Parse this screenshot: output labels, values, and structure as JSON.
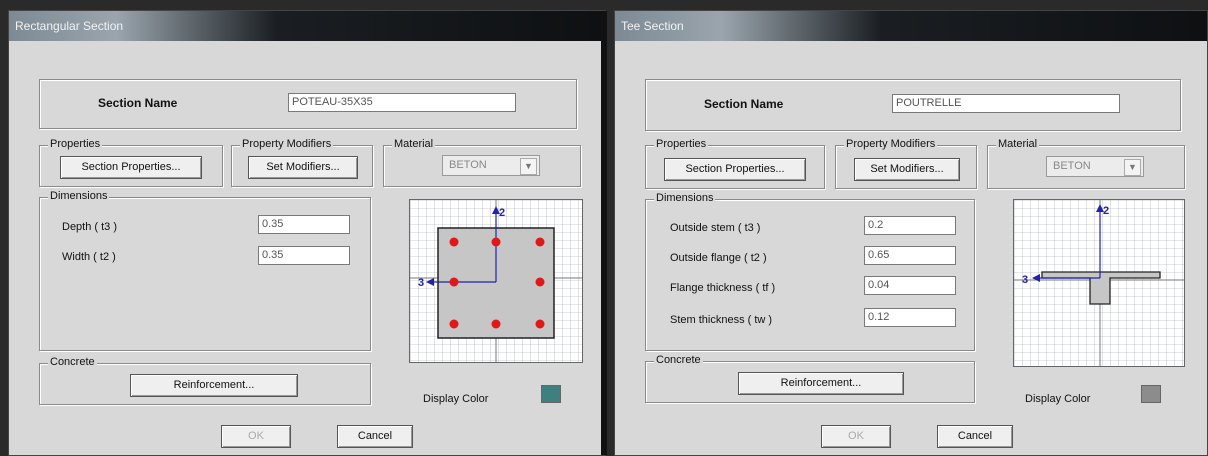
{
  "left": {
    "title": "Rectangular Section",
    "section_name_label": "Section Name",
    "section_name_value": "POTEAU-35X35",
    "properties_legend": "Properties",
    "section_properties_btn": "Section Properties...",
    "modifiers_legend": "Property Modifiers",
    "set_modifiers_btn": "Set Modifiers...",
    "material_legend": "Material",
    "material_value": "BETON",
    "dimensions_legend": "Dimensions",
    "dims": [
      {
        "label": "Depth ( t3 )",
        "value": "0.35"
      },
      {
        "label": "Width ( t2 )",
        "value": "0.35"
      }
    ],
    "axis_2": "2",
    "axis_3": "3",
    "concrete_legend": "Concrete",
    "reinforcement_btn": "Reinforcement...",
    "display_color_label": "Display Color",
    "display_color": "#3f7f7f",
    "ok_btn": "OK",
    "cancel_btn": "Cancel"
  },
  "right": {
    "title": "Tee Section",
    "section_name_label": "Section Name",
    "section_name_value": "POUTRELLE",
    "properties_legend": "Properties",
    "section_properties_btn": "Section Properties...",
    "modifiers_legend": "Property Modifiers",
    "set_modifiers_btn": "Set Modifiers...",
    "material_legend": "Material",
    "material_value": "BETON",
    "dimensions_legend": "Dimensions",
    "dims": [
      {
        "label": "Outside stem ( t3 )",
        "value": "0.2"
      },
      {
        "label": "Outside flange ( t2 )",
        "value": "0.65"
      },
      {
        "label": "Flange thickness ( tf )",
        "value": "0.04"
      },
      {
        "label": "Stem thickness ( tw )",
        "value": "0.12"
      }
    ],
    "axis_2": "2",
    "axis_3": "3",
    "concrete_legend": "Concrete",
    "reinforcement_btn": "Reinforcement...",
    "display_color_label": "Display Color",
    "display_color": "#8c8c8c",
    "ok_btn": "OK",
    "cancel_btn": "Cancel"
  },
  "colors": {
    "rebar": "#e01818",
    "axis": "#2222aa"
  },
  "icons": {
    "dropdown": "chevron-down-icon"
  }
}
